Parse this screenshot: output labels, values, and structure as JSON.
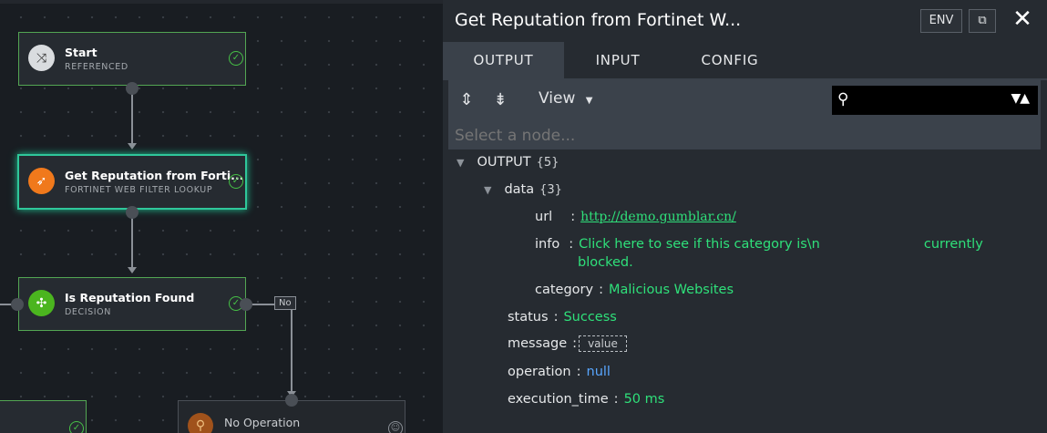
{
  "canvas": {
    "nodes": [
      {
        "title": "Start",
        "subtitle": "REFERENCED",
        "icon": "flow-icon",
        "icon_color": "#d9dcdf"
      },
      {
        "title": "Get Reputation from Forti...",
        "subtitle": "FORTINET WEB FILTER LOOKUP",
        "icon": "feather-icon",
        "icon_color": "#f0791c"
      },
      {
        "title": "Is Reputation Found",
        "subtitle": "DECISION",
        "icon": "decision-icon",
        "icon_color": "#4bb51f"
      },
      {
        "title": "No Operation",
        "subtitle": "",
        "icon": "pin-icon",
        "icon_color": "#a0521b"
      }
    ],
    "no_label": "No",
    "status_color": "#46c046"
  },
  "panel": {
    "title": "Get Reputation from Fortinet W...",
    "env_label": "ENV",
    "tabs": [
      "OUTPUT",
      "INPUT",
      "CONFIG"
    ],
    "active_tab": "OUTPUT",
    "toolbar": {
      "view_label": "View",
      "search_value": "",
      "select_placeholder": "Select a node..."
    },
    "tree": {
      "root_label": "OUTPUT",
      "root_count": "{5}",
      "data_label": "data",
      "data_count": "{3}",
      "url_key": "url",
      "url_value": "http://demo.gumblar.cn/",
      "info_key": "info",
      "info_value_line1": "Click here to see if this category is\\n",
      "info_value_line1b": "currently",
      "info_value_line2": "blocked.",
      "category_key": "category",
      "category_value": "Malicious Websites",
      "status_key": "status",
      "status_value": "Success",
      "message_key": "message",
      "message_value": "value",
      "operation_key": "operation",
      "operation_value": "null",
      "execution_time_key": "execution_time",
      "execution_time_value": "50 ms"
    }
  }
}
